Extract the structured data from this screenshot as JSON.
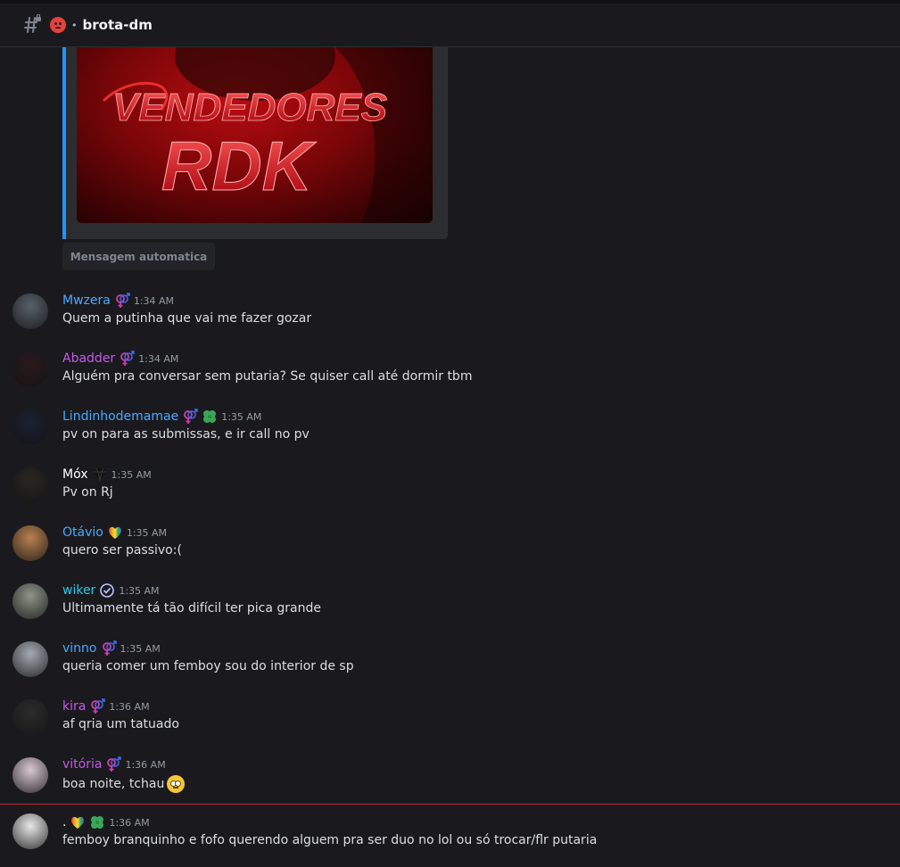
{
  "header": {
    "channel_name": "brota-dm",
    "separator": "•",
    "icons": [
      "hash-lock-icon",
      "angry-face-emoji"
    ]
  },
  "embed": {
    "image_text_top": "VENDEDORES",
    "image_text_bottom": "RDK",
    "accent_color": "#1e96fc",
    "button_label": "Mensagem automatica"
  },
  "messages": [
    {
      "username": "Mwzera",
      "color": "#4aa8ff",
      "time": "1:34 AM",
      "text": "Quem a putinha que vai me fazer gozar",
      "badges": [
        "gender-symbol-icon"
      ],
      "avatar": "#59606b"
    },
    {
      "username": "Abadder",
      "color": "#c658e8",
      "time": "1:34 AM",
      "text": "Alguém pra conversar sem putaria? Se quiser call até dormir tbm",
      "badges": [
        "gender-symbol-icon"
      ],
      "avatar": "#2a1a1e"
    },
    {
      "username": "Lindinhodemamae",
      "color": "#4aa8ff",
      "time": "1:35 AM",
      "text": "pv on para as submissas, e ir call no pv",
      "badges": [
        "gender-symbol-icon",
        "clover-icon"
      ],
      "avatar": "#1b2130"
    },
    {
      "username": "Móx",
      "color": "#ffffff",
      "time": "1:35 AM",
      "text": "Pv on Rj",
      "badges": [
        "gem-icon"
      ],
      "avatar": "#2a2624"
    },
    {
      "username": "Otávio",
      "color": "#4aa8ff",
      "time": "1:35 AM",
      "text": "quero ser passivo:(",
      "badges": [
        "rainbow-heart-icon"
      ],
      "avatar": "#b98150"
    },
    {
      "username": "wiker",
      "color": "#2fc8e8",
      "time": "1:35 AM",
      "text": "Ultimamente tá tão difícil ter pica grande",
      "badges": [
        "verified-icon"
      ],
      "avatar": "#8d9488"
    },
    {
      "username": "vinno",
      "color": "#4aa8ff",
      "time": "1:35 AM",
      "text": "queria comer um femboy sou do interior de sp",
      "badges": [
        "gender-symbol-icon"
      ],
      "avatar": "#a4aab2"
    },
    {
      "username": "kira",
      "color": "#c658e8",
      "time": "1:36 AM",
      "text": "af qria um tatuado",
      "badges": [
        "gender-symbol-icon"
      ],
      "avatar": "#2c2c2c"
    },
    {
      "username": "vitória",
      "color": "#c658e8",
      "time": "1:36 AM",
      "text": "boa noite, tchau",
      "badges": [
        "gender-symbol-icon"
      ],
      "avatar": "#d8c8d2",
      "trailing_emoji": "eye-roll-emoji"
    },
    {
      "username": ".",
      "color": "#ffffff",
      "time": "1:36 AM",
      "text": "femboy branquinho e fofo querendo alguem pra ser duo no lol ou só trocar/flr putaria",
      "badges": [
        "rainbow-heart-icon",
        "clover-icon"
      ],
      "avatar": "#e8e8e8"
    }
  ]
}
